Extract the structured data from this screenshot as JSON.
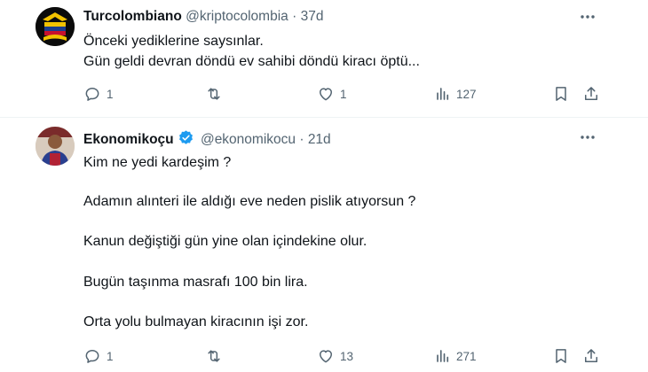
{
  "tweets": [
    {
      "name": "Turcolombiano",
      "handle": "@kriptocolombia",
      "separator": "·",
      "time": "37d",
      "lines": [
        "Önceki yediklerine saysınlar.",
        "Gün geldi devran döndü ev sahibi döndü kiracı öptü..."
      ],
      "replies": "1",
      "reposts": "",
      "likes": "1",
      "views": "127",
      "verified": false
    },
    {
      "name": "Ekonomikoçu",
      "handle": "@ekonomikocu",
      "separator": "·",
      "time": "21d",
      "lines": [
        "Kim ne yedi kardeşim ?",
        "Adamın alınteri ile aldığı eve neden pislik atıyorsun ?",
        "Kanun değiştiği gün yine olan içindekine olur.",
        "Bugün taşınma masrafı 100 bin lira.",
        "Orta yolu bulmayan kiracının işi zor."
      ],
      "replies": "1",
      "reposts": "",
      "likes": "13",
      "views": "271",
      "verified": true
    }
  ],
  "colors": {
    "text": "#0f1419",
    "muted": "#536471",
    "verified": "#1d9bf0",
    "divider": "#eff3f4"
  },
  "icons": [
    "more-icon",
    "reply-icon",
    "repost-icon",
    "like-icon",
    "views-icon",
    "bookmark-icon",
    "share-icon",
    "verified-badge-icon"
  ]
}
